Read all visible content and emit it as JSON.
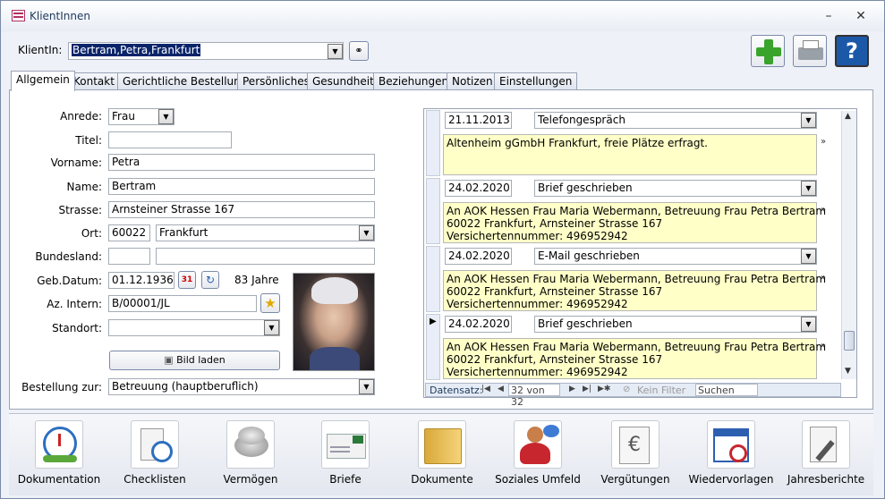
{
  "window": {
    "title": "KlientInnen"
  },
  "header": {
    "client_label": "KlientIn:",
    "client_value": "Bertram,Petra,Frankfurt"
  },
  "tabs": [
    {
      "label": "Allgemein"
    },
    {
      "label": "Kontakt"
    },
    {
      "label": "Gerichtliche Bestellung"
    },
    {
      "label": "Persönliches"
    },
    {
      "label": "Gesundheit"
    },
    {
      "label": "Beziehungen"
    },
    {
      "label": "Notizen"
    },
    {
      "label": "Einstellungen"
    }
  ],
  "form": {
    "anrede_label": "Anrede:",
    "anrede_value": "Frau",
    "titel_label": "Titel:",
    "titel_value": "",
    "vorname_label": "Vorname:",
    "vorname_value": "Petra",
    "name_label": "Name:",
    "name_value": "Bertram",
    "strasse_label": "Strasse:",
    "strasse_value": "Arnsteiner Strasse 167",
    "ort_label": "Ort:",
    "plz_value": "60022",
    "ort_value": "Frankfurt",
    "bundesland_label": "Bundesland:",
    "bundesland_value": "",
    "gebdatum_label": "Geb.Datum:",
    "gebdatum_value": "01.12.1936",
    "age_text": "83 Jahre",
    "az_label": "Az. Intern:",
    "az_value": "B/00001/JL",
    "standort_label": "Standort:",
    "standort_value": "",
    "bild_button": "Bild laden",
    "bestellung_label": "Bestellung zur:",
    "bestellung_value": "Betreuung (hauptberuflich)"
  },
  "entries": [
    {
      "date": "21.11.2013",
      "type": "Telefongespräch",
      "note": "Altenheim gGmbH Frankfurt, freie Plätze erfragt."
    },
    {
      "date": "24.02.2020",
      "type": "Brief geschrieben",
      "note": "An AOK Hessen Frau Maria Webermann, Betreuung Frau Petra Bertram\n60022 Frankfurt, Arnsteiner Strasse 167\nVersichertennummer: 496952942"
    },
    {
      "date": "24.02.2020",
      "type": "E-Mail geschrieben",
      "note": "An AOK Hessen Frau Maria Webermann, Betreuung Frau Petra Bertram\n60022 Frankfurt, Arnsteiner Strasse 167\nVersichertennummer: 496952942"
    },
    {
      "date": "24.02.2020",
      "type": "Brief geschrieben",
      "note": "An AOK Hessen Frau Maria Webermann, Betreuung Frau Petra Bertram\n60022 Frankfurt, Arnsteiner Strasse 167\nVersichertennummer: 496952942"
    }
  ],
  "navigation": {
    "label": "Datensatz:",
    "position": "32 von 32",
    "filter": "Kein Filter",
    "search": "Suchen"
  },
  "bottom_buttons": [
    {
      "label": "Dokumentation",
      "icon": "clock-document-icon"
    },
    {
      "label": "Checklisten",
      "icon": "alarm-clock-list-icon"
    },
    {
      "label": "Vermögen",
      "icon": "coins-icon"
    },
    {
      "label": "Briefe",
      "icon": "letter-icon"
    },
    {
      "label": "Dokumente",
      "icon": "folder-icon"
    },
    {
      "label": "Soziales Umfeld",
      "icon": "people-icon"
    },
    {
      "label": "Vergütungen",
      "icon": "euro-pen-icon"
    },
    {
      "label": "Wiedervorlagen",
      "icon": "calendar-icon"
    },
    {
      "label": "Jahresberichte",
      "icon": "report-pen-icon"
    }
  ],
  "colors": {
    "note_bg": "#ffffc8",
    "accent_green": "#3aa32c",
    "help_blue": "#1c58a8"
  }
}
